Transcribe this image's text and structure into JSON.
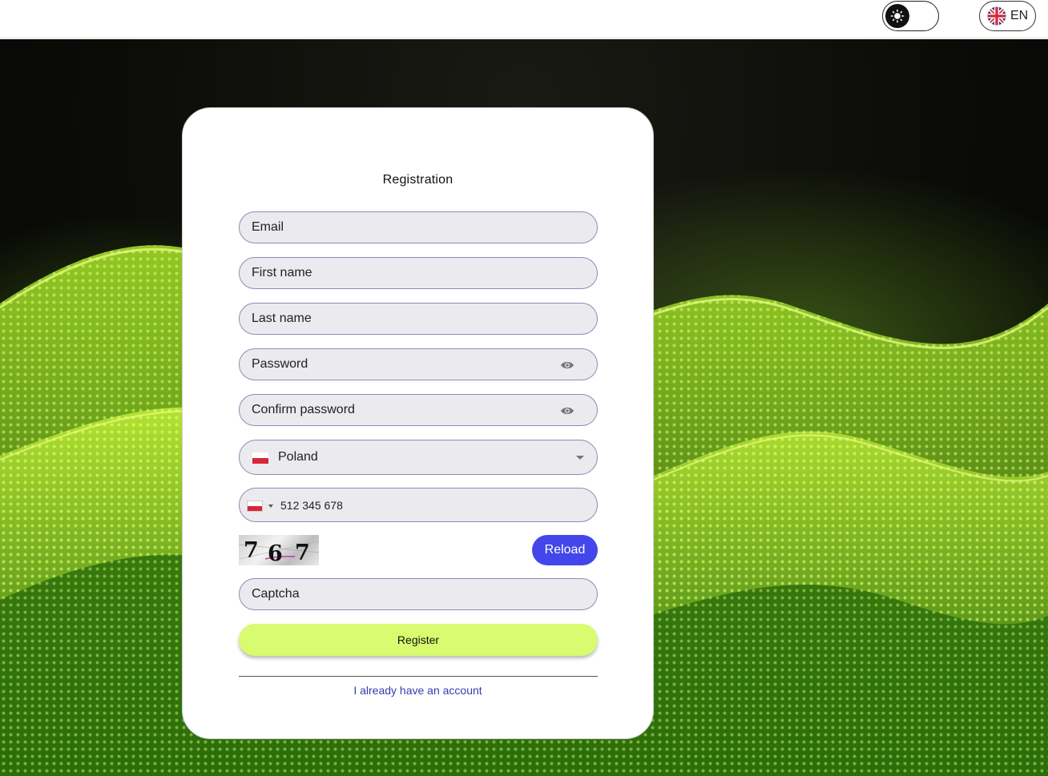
{
  "header": {
    "language_code": "EN",
    "theme_icons": [
      "sun-icon",
      "moon-icon"
    ],
    "language_icon": "uk-flag-icon"
  },
  "form": {
    "title": "Registration",
    "email_placeholder": "Email",
    "first_name_placeholder": "First name",
    "last_name_placeholder": "Last name",
    "password_placeholder": "Password",
    "confirm_password_placeholder": "Confirm password",
    "country_value": "Poland",
    "phone_value": "512 345 678",
    "captcha_digits": [
      "7",
      "6",
      "7"
    ],
    "reload_label": "Reload",
    "captcha_placeholder": "Captcha",
    "register_label": "Register",
    "login_link": "I already have an account"
  },
  "colors": {
    "primary": "#4346ea",
    "accent": "#d8fb70",
    "field_border": "#8e8ab6",
    "field_bg": "#ebebef",
    "link": "#3d38b0"
  }
}
